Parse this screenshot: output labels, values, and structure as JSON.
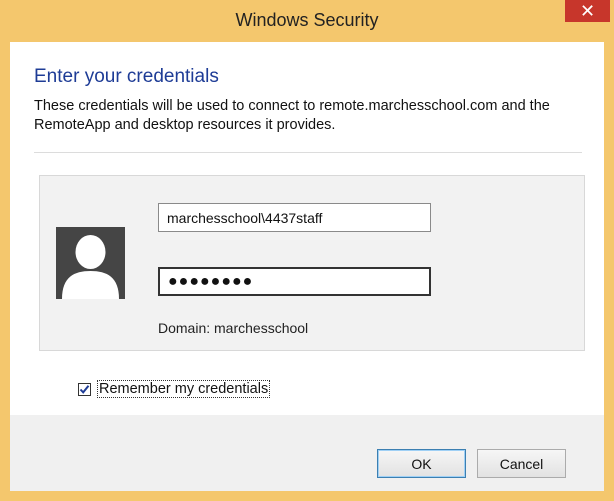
{
  "window": {
    "title": "Windows Security",
    "close_glyph": "✕"
  },
  "dialog": {
    "heading": "Enter your credentials",
    "description": "These credentials will be used to connect to remote.marchesschool.com and the RemoteApp and desktop resources it provides."
  },
  "credentials": {
    "avatar_icon": "user-silhouette-icon",
    "username_value": "marchesschool\\4437staff",
    "password_value": "●●●●●●●●",
    "domain_text": "Domain: marchesschool"
  },
  "remember": {
    "label": "Remember my credentials",
    "checked": true
  },
  "buttons": {
    "ok_label": "OK",
    "cancel_label": "Cancel"
  },
  "colors": {
    "titlebar": "#f4c76d",
    "close": "#c7362b",
    "heading": "#1e3c96"
  }
}
